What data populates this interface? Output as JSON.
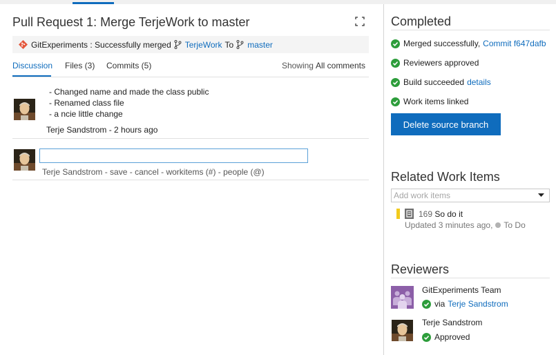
{
  "colors": {
    "accent": "#0f6cbd",
    "success": "#2d9d3b",
    "work_item_bar": "#f2cb1d",
    "team_avatar": "#8c5fa8"
  },
  "pull_request": {
    "title": "Pull Request 1: Merge TerjeWork to master",
    "banner": {
      "repo_status": "GitExperiments : Successfully merged",
      "source_branch": "TerjeWork",
      "to_word": "To",
      "target_branch": "master"
    }
  },
  "tabs": [
    {
      "label": "Discussion",
      "active": true
    },
    {
      "label": "Files (3)",
      "active": false
    },
    {
      "label": "Commits (5)",
      "active": false
    }
  ],
  "filter": {
    "label": "Showing",
    "value": "All comments"
  },
  "comment": {
    "lines": [
      "- Changed name and made the class public",
      "- Renamed class file",
      "- a ncie little change"
    ],
    "author_time": "Terje Sandstrom - 2 hours ago"
  },
  "reply": {
    "author": "Terje Sandstrom",
    "sep": " - ",
    "save": "save",
    "cancel": "cancel",
    "workitems": "workitems (#)",
    "people": "people (@)"
  },
  "completed": {
    "title": "Completed",
    "items": [
      {
        "text": "Merged successfully,",
        "link": "Commit f647dafb"
      },
      {
        "text": "Reviewers approved",
        "link": ""
      },
      {
        "text": "Build succeeded",
        "link": "details"
      },
      {
        "text": "Work items linked",
        "link": ""
      }
    ],
    "delete_button": "Delete source branch"
  },
  "related_work_items": {
    "title": "Related Work Items",
    "add_placeholder": "Add work items",
    "items": [
      {
        "id": "169",
        "title": "So do it",
        "updated": "Updated 3 minutes ago,",
        "state": "To Do"
      }
    ]
  },
  "reviewers": {
    "title": "Reviewers",
    "items": [
      {
        "name": "GitExperiments Team",
        "via_label": "via",
        "via_link": "Terje Sandstrom"
      },
      {
        "name": "Terje Sandstrom",
        "status": "Approved"
      }
    ]
  },
  "icons": {
    "fullscreen": "fullscreen-icon",
    "git": "git-icon",
    "branch": "branch-icon",
    "check": "check-circle-icon",
    "dropdown": "chevron-down-icon",
    "work_item_type": "product-backlog-item-icon",
    "team": "team-icon"
  }
}
